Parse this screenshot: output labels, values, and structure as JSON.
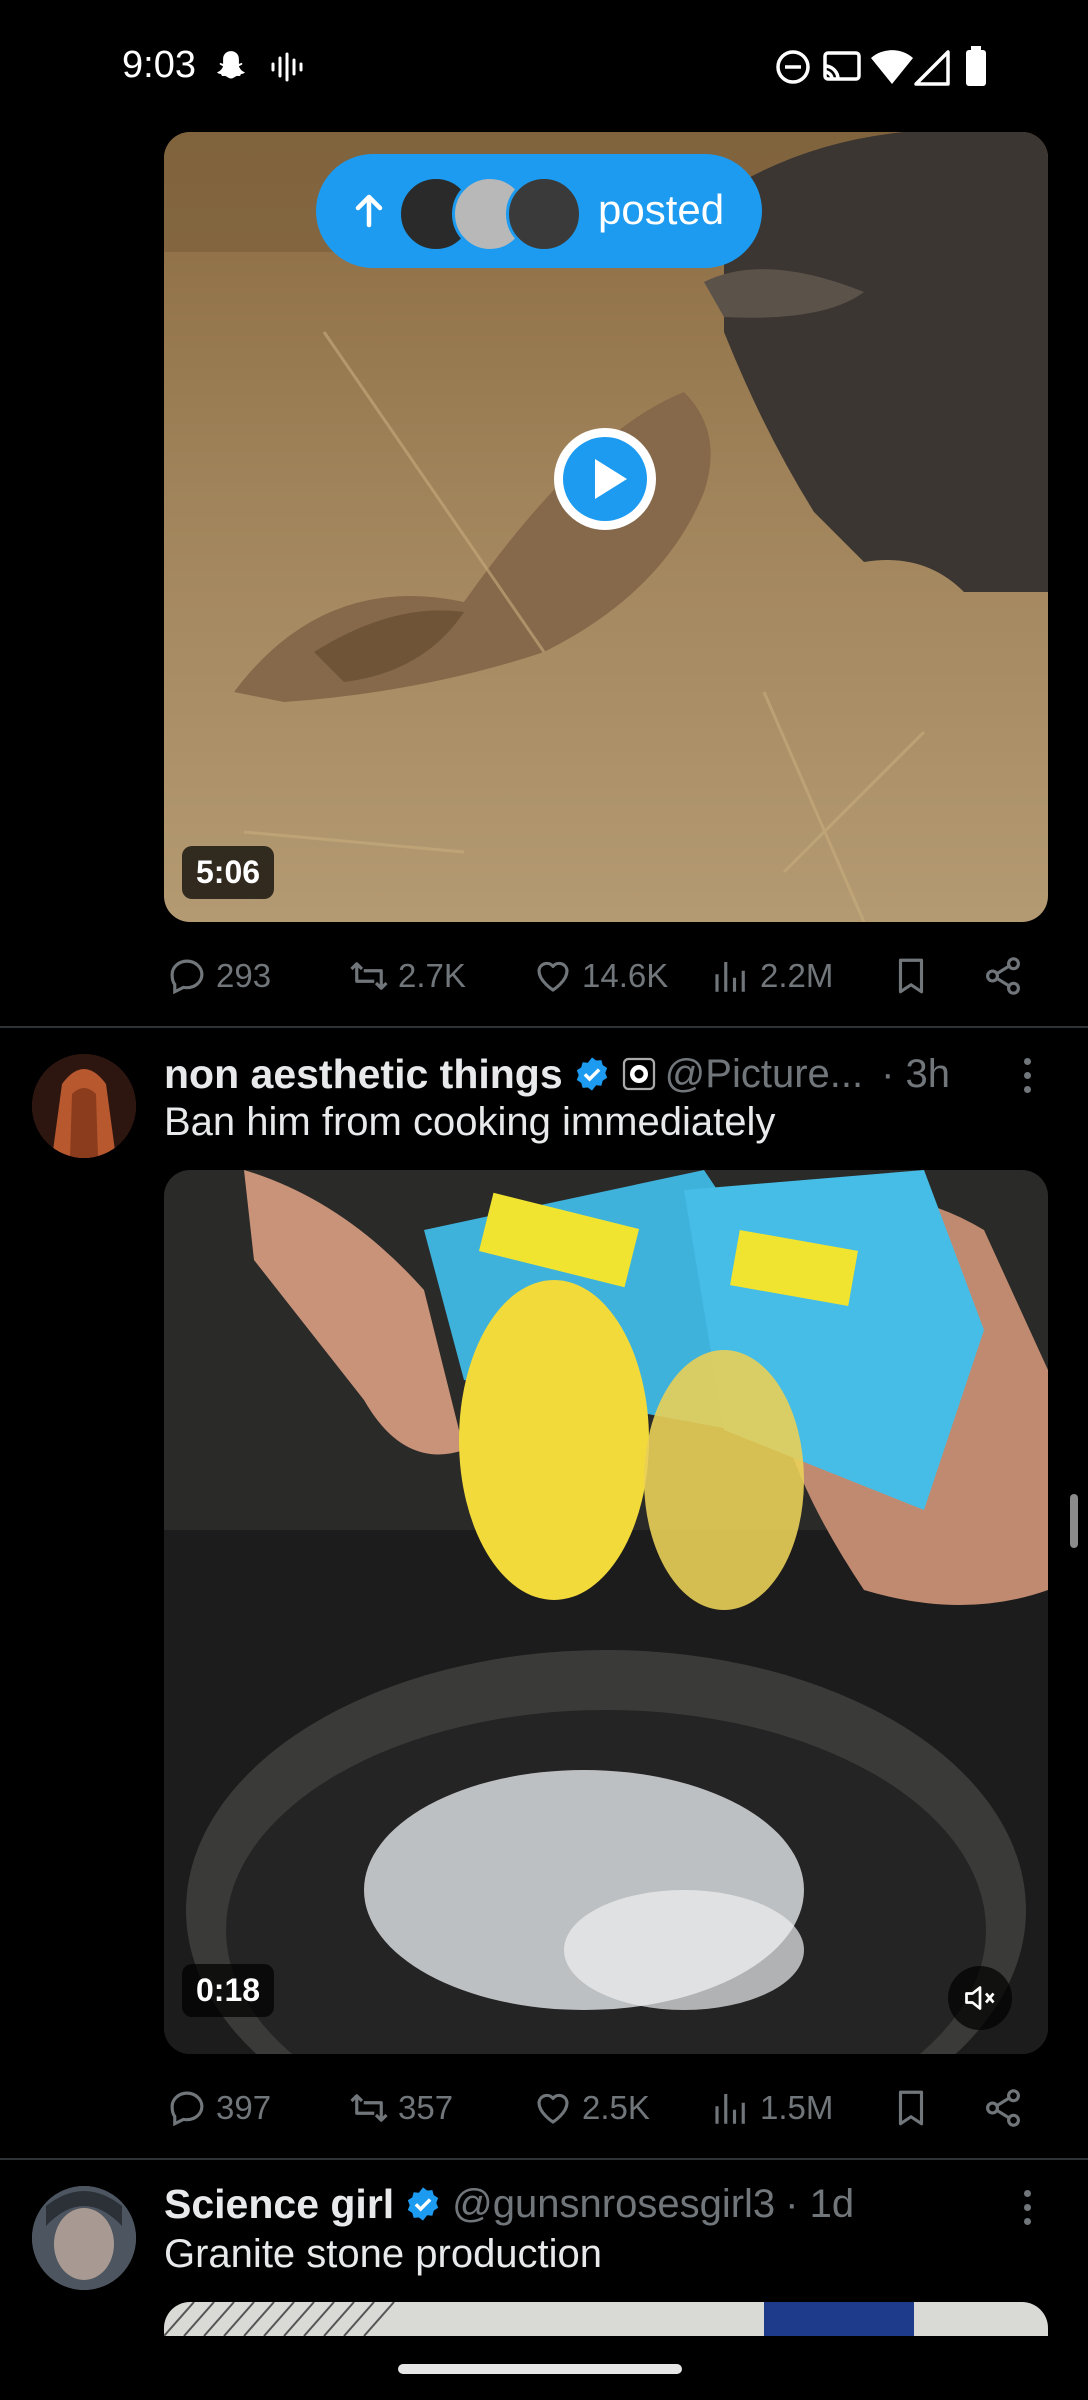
{
  "status_bar": {
    "time": "9:03"
  },
  "posted_pill": {
    "label": "posted"
  },
  "post1": {
    "duration": "5:06",
    "replies": "293",
    "reposts": "2.7K",
    "likes": "14.6K",
    "views": "2.2M"
  },
  "post2": {
    "author_name": "non aesthetic things",
    "handle": "@Picture...",
    "time": "· 3h",
    "text": "Ban him from cooking immediately",
    "duration": "0:18",
    "replies": "397",
    "reposts": "357",
    "likes": "2.5K",
    "views": "1.5M"
  },
  "post3": {
    "author_name": "Science girl",
    "handle": "@gunsnrosesgirl3",
    "time": "· 1d",
    "text": "Granite stone production"
  },
  "colors": {
    "accent": "#1d9bf0",
    "background": "#000000",
    "muted": "#71767b",
    "divider": "#2f3336"
  },
  "icons": [
    "snapchat-ghost-icon",
    "voice-wave-icon",
    "dnd-icon",
    "cast-icon",
    "wifi-icon",
    "signal-icon",
    "battery-icon",
    "up-arrow-icon",
    "play-icon",
    "reply-icon",
    "repost-icon",
    "like-icon",
    "views-icon",
    "bookmark-icon",
    "share-icon",
    "verified-badge-icon",
    "affiliate-badge-icon",
    "more-icon",
    "mute-icon"
  ]
}
